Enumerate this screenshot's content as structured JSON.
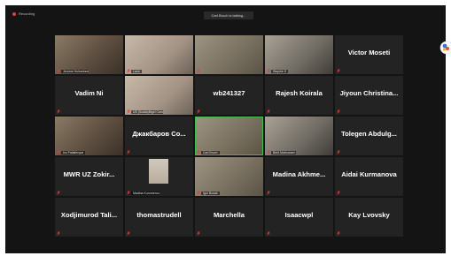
{
  "topbar": {
    "recording_label": "Recording",
    "speaker_text": "Carl Bruch is talking..."
  },
  "colors": {
    "window_bg": "#141414",
    "tile_bg": "#232323",
    "recording_dot": "#e43b3b",
    "mute_icon": "#e23c3c",
    "speaking_border": "#3fbf4a"
  },
  "participants": [
    {
      "name": "",
      "caption": "Jerome Holmebeck",
      "video": true
    },
    {
      "name": "",
      "caption": "Larin",
      "video": true
    },
    {
      "name": "",
      "caption": "",
      "video": true
    },
    {
      "name": "",
      "caption": "Stephie S",
      "video": true
    },
    {
      "name": "Victor Moseti",
      "caption": "",
      "video": false
    },
    {
      "name": "Vadim Ni",
      "caption": "",
      "video": false
    },
    {
      "name": "",
      "caption": "US (Scalia)Bigel Carlos",
      "video": true
    },
    {
      "name": "wb241327",
      "caption": "",
      "video": false
    },
    {
      "name": "Rajesh Koirala",
      "caption": "",
      "video": false
    },
    {
      "name": "Jiyoun Christina...",
      "caption": "",
      "video": false
    },
    {
      "name": "",
      "caption": "Ivo Pallaferque",
      "video": true
    },
    {
      "name": "Джакбаров Со...",
      "caption": "",
      "video": false
    },
    {
      "name": "",
      "caption": "Carl Bruch",
      "video": true,
      "speaking": true
    },
    {
      "name": "",
      "caption": "Berit Markussen",
      "video": true
    },
    {
      "name": "Tolegen Abdulg...",
      "caption": "",
      "video": false
    },
    {
      "name": "MWR UZ Zokir...",
      "caption": "",
      "video": false
    },
    {
      "name": "",
      "caption": "Madina Kurumerova",
      "video": false,
      "avatar": true
    },
    {
      "name": "",
      "caption": "Igor Bosak",
      "video": true
    },
    {
      "name": "Madina Akhme...",
      "caption": "",
      "video": false
    },
    {
      "name": "Aidai Kurmanova",
      "caption": "",
      "video": false
    },
    {
      "name": "Xodjimurod Tali...",
      "caption": "",
      "video": false
    },
    {
      "name": "thomastrudell",
      "caption": "",
      "video": false
    },
    {
      "name": "Marchella",
      "caption": "",
      "video": false
    },
    {
      "name": "Isaacwpl",
      "caption": "",
      "video": false
    },
    {
      "name": "Kay Lvovsky",
      "caption": "",
      "video": false
    }
  ]
}
